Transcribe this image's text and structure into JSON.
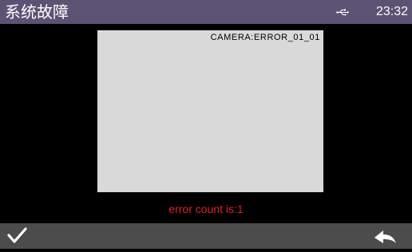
{
  "status_bar": {
    "title": "系统故障",
    "usb_icon": "usb-icon",
    "time": "23:32",
    "background": "#5c5273"
  },
  "camera": {
    "label": "CAMERA:ERROR_01_01",
    "preview_color": "#d9d9d9"
  },
  "error": {
    "message": "error count is:1",
    "color": "#e21f26"
  },
  "toolbar": {
    "confirm_icon": "check-icon",
    "back_icon": "back-arrow-icon",
    "background": "#4c4c4c"
  }
}
